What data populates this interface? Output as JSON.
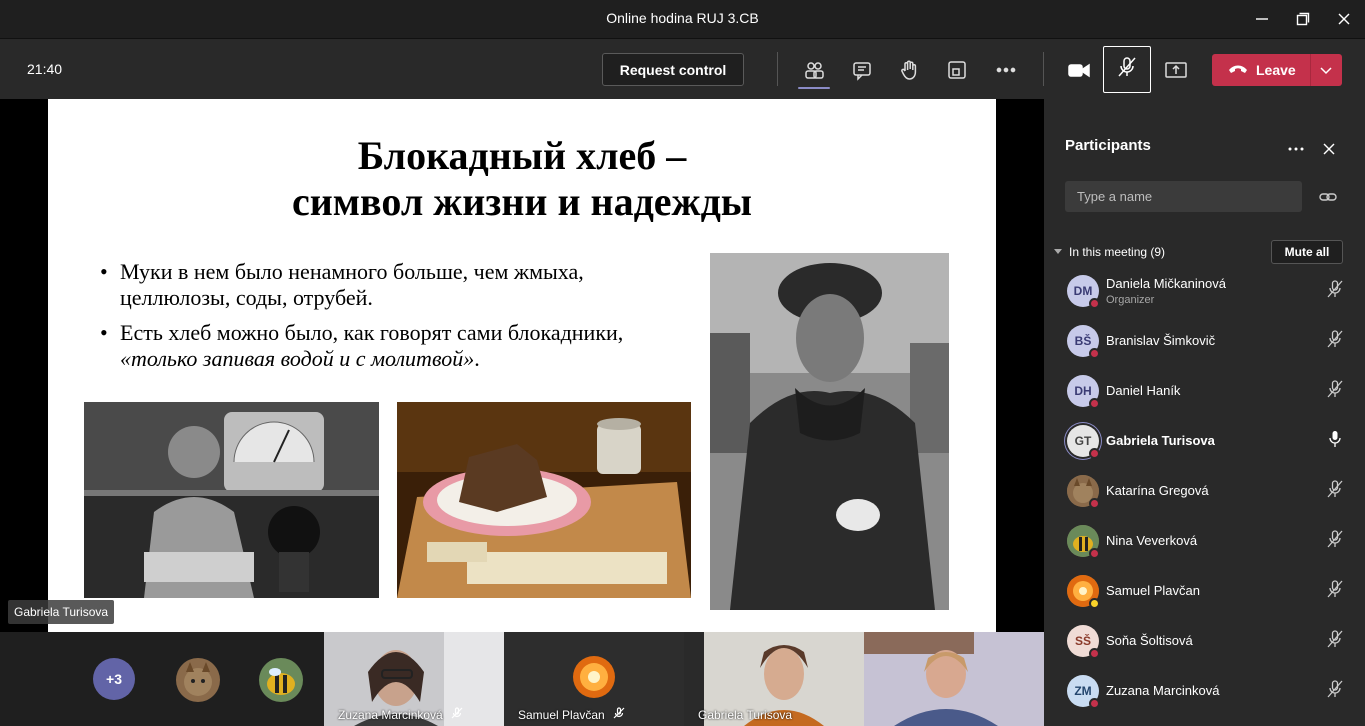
{
  "window": {
    "title": "Online hodina RUJ 3.CB"
  },
  "toolbar": {
    "time": "21:40",
    "request_control": "Request control",
    "leave": "Leave",
    "icons": [
      "people-icon",
      "chat-icon",
      "raise-hand-icon",
      "room-icon",
      "more-icon",
      "camera-icon",
      "mic-off-icon",
      "share-icon"
    ]
  },
  "slide": {
    "title_line1": "Блокадный хлеб –",
    "title_line2": "символ жизни и надежды",
    "bullet1": "Муки в нем было ненамного больше, чем жмыха, целлюлозы, соды, отрубей.",
    "bullet2_plain": "Есть хлеб можно было, как говорят сами блокадники, ",
    "bullet2_italic": "«только запивая водой и с молитвой»",
    "bullet2_end": "."
  },
  "presenter": {
    "name": "Gabriela Turisova"
  },
  "strip": {
    "more_count": "+3",
    "tiles": [
      {
        "name": "Zuzana Marcinková"
      },
      {
        "name": "Samuel Plavčan"
      },
      {
        "name": "Gabriela Turisova"
      }
    ]
  },
  "participants": {
    "title": "Participants",
    "search_placeholder": "Type a name",
    "section_label": "In this meeting (9)",
    "mute_all": "Mute all",
    "people": [
      {
        "initials": "DM",
        "name": "Daniela Mičkaninová",
        "role": "Organizer",
        "mic": "off"
      },
      {
        "initials": "BŠ",
        "name": "Branislav Šimkovič",
        "role": "",
        "mic": "off"
      },
      {
        "initials": "DH",
        "name": "Daniel Haník",
        "role": "",
        "mic": "off"
      },
      {
        "initials": "GT",
        "name": "Gabriela Turisova",
        "role": "",
        "mic": "on"
      },
      {
        "initials": "",
        "name": "Katarína Gregová",
        "role": "",
        "mic": "off"
      },
      {
        "initials": "",
        "name": "Nina Veverková",
        "role": "",
        "mic": "off"
      },
      {
        "initials": "",
        "name": "Samuel Plavčan",
        "role": "",
        "mic": "off"
      },
      {
        "initials": "SŠ",
        "name": "Soňa Šoltisová",
        "role": "",
        "mic": "off"
      },
      {
        "initials": "ZM",
        "name": "Zuzana Marcinková",
        "role": "",
        "mic": "off"
      }
    ]
  },
  "colors": {
    "accent": "#6264a7",
    "leave": "#c4314b",
    "panel": "#292929"
  }
}
